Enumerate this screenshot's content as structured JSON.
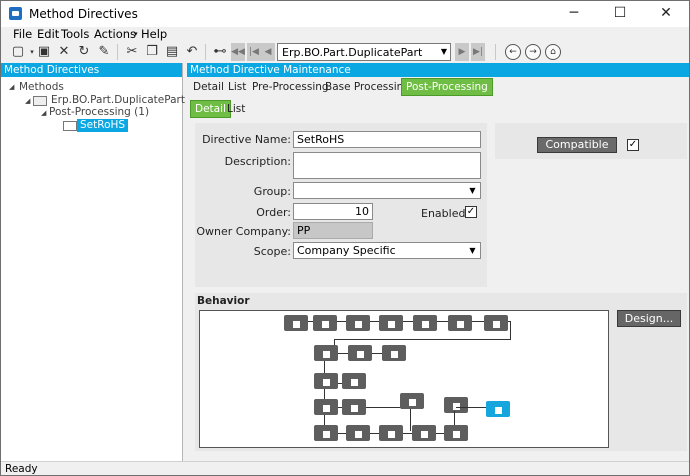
{
  "window": {
    "title": "Method Directives",
    "minimize": "─",
    "maximize": "☐",
    "close": "✕"
  },
  "menu": [
    {
      "label": "File"
    },
    {
      "label": "Edit"
    },
    {
      "label": "Tools"
    },
    {
      "label": "Actions"
    },
    {
      "label": "Help"
    }
  ],
  "toolbar": {
    "new_icon": "new-icon",
    "save_icon": "save-icon",
    "delete_icon": "delete-icon",
    "refresh_icon": "refresh-icon",
    "clear_icon": "clear-icon",
    "cut_icon": "cut-icon",
    "copy_icon": "copy-icon",
    "paste_icon": "paste-icon",
    "undo_icon": "undo-icon",
    "binoculars_icon": "binoculars-icon",
    "record_selector": "Erp.BO.Part.DuplicatePart"
  },
  "left_panel": {
    "header": "Method Directives",
    "tree": {
      "root": "Methods",
      "method": "Erp.BO.Part.DuplicatePart",
      "group": "Post-Processing (1)",
      "selected": "SetRoHS"
    }
  },
  "right_panel": {
    "header": "Method Directive Maintenance",
    "tabs": [
      "Detail",
      "List",
      "Pre-Processing",
      "Base Processing",
      "Post-Processing"
    ],
    "active_tab": "Post-Processing",
    "sub_tabs": [
      "Detail",
      "List"
    ],
    "active_sub_tab": "Detail",
    "form": {
      "directive_name_label": "Directive Name:",
      "directive_name": "SetRoHS",
      "description_label": "Description:",
      "description": "",
      "group_label": "Group:",
      "group": "",
      "order_label": "Order:",
      "order": "10",
      "enabled_label": "Enabled:",
      "enabled": true,
      "owner_company_label": "Owner Company:",
      "owner_company": "PP",
      "scope_label": "Scope:",
      "scope": "Company Specific"
    },
    "compatible": {
      "button_label": "Compatible",
      "checked": true
    },
    "behavior": {
      "title": "Behavior",
      "design_button": "Design..."
    }
  },
  "status": {
    "text": "Ready"
  }
}
